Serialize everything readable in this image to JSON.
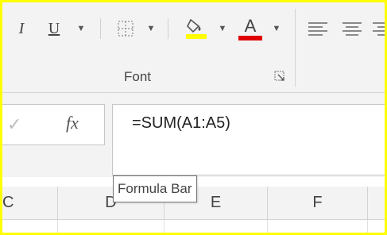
{
  "ribbon": {
    "italic_label": "I",
    "underline_label": "U",
    "font_color_letter": "A",
    "group_label": "Font",
    "fill_color": "#ffff00",
    "font_color": "#e00000"
  },
  "formula_bar": {
    "cancel_glyph": "✓",
    "fx_label": "fx",
    "formula": "=SUM(A1:A5)"
  },
  "grid": {
    "columns": [
      "C",
      "D",
      "E",
      "F",
      ""
    ]
  },
  "tooltip": {
    "text": "Formula Bar"
  }
}
